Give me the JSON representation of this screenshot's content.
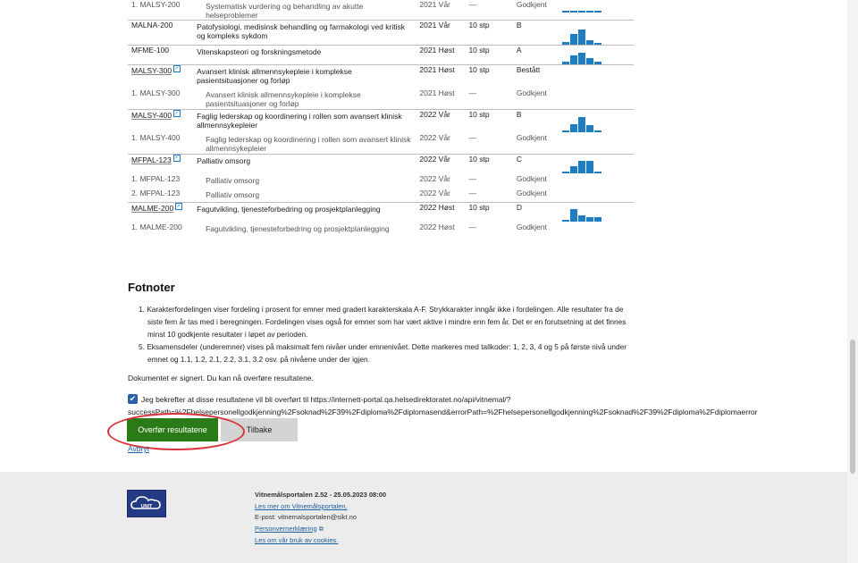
{
  "results": [
    {
      "kind": "sub",
      "code": "1. MALSY-200",
      "name": "Systematisk vurdering og behandling av akutte helseproblemer",
      "semester": "2021 Vår",
      "credits": "—",
      "grade": "Godkjent",
      "dist": [
        4,
        4,
        4,
        4,
        4
      ]
    },
    {
      "kind": "main",
      "code": "MALNA-200",
      "code_link": false,
      "name": "Patofysiologi, medisinsk behandling og farmakologi ved kritisk og kompleks sykdom",
      "semester": "2021 Vår",
      "credits": "10 stp",
      "grade": "B",
      "dist": [
        15,
        50,
        75,
        20,
        3
      ]
    },
    {
      "kind": "main",
      "code": "MFME-100",
      "code_link": false,
      "name": "Vitenskapsteori og forskningsmetode",
      "semester": "2021 Høst",
      "credits": "10 stp",
      "grade": "A",
      "dist": [
        18,
        60,
        75,
        40,
        20
      ]
    },
    {
      "kind": "main",
      "code": "MALSY-300",
      "code_link": true,
      "name": "Avansert klinisk allmennsykepleie i komplekse pasientsituasjoner og forløp",
      "semester": "2021 Høst",
      "credits": "10 stp",
      "grade": "Bestått",
      "dist": []
    },
    {
      "kind": "sub",
      "code": "1. MALSY-300",
      "name": "Avansert klinisk allmennsykepleie i komplekse pasientsituasjoner og forløp",
      "semester": "2021 Høst",
      "credits": "—",
      "grade": "Godkjent",
      "dist": []
    },
    {
      "kind": "main",
      "code": "MALSY-400",
      "code_link": true,
      "name": "Faglig lederskap og koordinering i rollen som avansert klinisk allmennsykepleier",
      "semester": "2022 Vår",
      "credits": "10 stp",
      "grade": "B",
      "dist": [
        10,
        45,
        80,
        40,
        10
      ]
    },
    {
      "kind": "sub",
      "code": "1. MALSY-400",
      "name": "Faglig lederskap og koordinering i rollen som avansert klinisk allmennsykepleier",
      "semester": "2022 Vår",
      "credits": "—",
      "grade": "Godkjent",
      "dist": []
    },
    {
      "kind": "main",
      "code": "MFPAL-123",
      "code_link": true,
      "name": "Palliativ omsorg",
      "semester": "2022 Vår",
      "credits": "10 stp",
      "grade": "C",
      "dist": [
        12,
        45,
        85,
        85,
        0
      ]
    },
    {
      "kind": "sub",
      "code": "1. MFPAL-123",
      "name": "Palliativ omsorg",
      "semester": "2022 Vår",
      "credits": "—",
      "grade": "Godkjent",
      "dist": []
    },
    {
      "kind": "sub",
      "code": "2. MFPAL-123",
      "name": "Palliativ omsorg",
      "semester": "2022 Vår",
      "credits": "—",
      "grade": "Godkjent",
      "dist": []
    },
    {
      "kind": "main",
      "code": "MALME-200",
      "code_link": true,
      "name": "Fagutvikling, tjenesteforbedring og prosjektplanlegging",
      "semester": "2022 Høst",
      "credits": "10 stp",
      "grade": "D",
      "dist": [
        10,
        85,
        40,
        30,
        30
      ]
    },
    {
      "kind": "sub",
      "code": "1. MALME-200",
      "name": "Fagutvikling, tjenesteforbedring og prosjektplanlegging",
      "semester": "2022 Høst",
      "credits": "—",
      "grade": "Godkjent",
      "dist": []
    }
  ],
  "footnotes": {
    "title": "Fotnoter",
    "items": [
      "1. Karakterfordelingen viser fordeling i prosent for emner med gradert karakterskala A-F. Strykkarakter inngår ikke i fordelingen. Alle resultater fra de siste fem år tas med i beregningen. Fordelingen vises også for emner som har vært aktive i mindre enn fem år. Det er en forutsetning at det finnes minst 10 godkjente resultater i løpet av perioden.",
      "5. Eksamensdeler (underemner) vises på maksimalt fem nivåer under emnenivået. Dette markeres med tallkoder: 1, 2, 3, 4 og 5 på første nivå under emnet og 1.1, 1.2, 2.1, 2.2, 3.1, 3.2 osv. på nivåene under der igjen."
    ]
  },
  "signed_text": "Dokumentet er signert. Du kan nå overføre resultatene.",
  "confirm": {
    "checked": true,
    "line1": "Jeg bekrefter at disse resultatene vil bli overført til https://internett-portal.qa.helsedirektoratet.no/api/vitnemal/?",
    "line2": "successPath=%2Fhelsepersonellgodkjenning%2Fsoknad%2F39%2Fdiploma%2Fdiplomasend&errorPath=%2Fhelsepersonellgodkjenning%2Fsoknad%2F39%2Fdiploma%2Fdiplomaerror"
  },
  "buttons": {
    "transfer": "Overfør resultatene",
    "back": "Tilbake",
    "cancel": "Avbryt"
  },
  "footer": {
    "logo_text": "UNIT",
    "version": "Vitnemålsportalen 2.52 - 25.05.2023 08:00",
    "more_link": "Les mer om Vitnemålsportalen.",
    "email": "E-post: vitnemalsportalen@sikt.no",
    "privacy_link": "Personvernerklæring",
    "cookies_link": "Les om vår bruk av cookies."
  },
  "colors": {
    "bars": "#1f7ec1",
    "primary_button": "#2b7a18",
    "annotation": "#d9333a"
  }
}
